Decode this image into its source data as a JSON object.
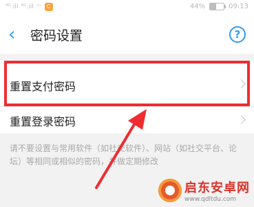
{
  "status_bar": {
    "signal_left": "⁴ᴳ.ıll",
    "wifi_left": "⁴ᴳ.ıll",
    "app_badge_glyph": "C",
    "battery_percent_text": "44%",
    "battery_level": 0.44,
    "time": "09:13"
  },
  "header": {
    "back_glyph": "‹",
    "title": "密码设置",
    "help_glyph": "?"
  },
  "rows": [
    {
      "label": "重置支付密码"
    },
    {
      "label": "重置登录密码"
    }
  ],
  "hint": "请不要设置与常用软件（如社交软件）、网站（如社交平台、论坛）等相同或相似的密码，并做定期修改",
  "watermark": {
    "title": "启东安卓网",
    "url": "www.qdltdu.com"
  },
  "colors": {
    "accent": "#2f9ceb",
    "highlight": "#ef2c31"
  }
}
